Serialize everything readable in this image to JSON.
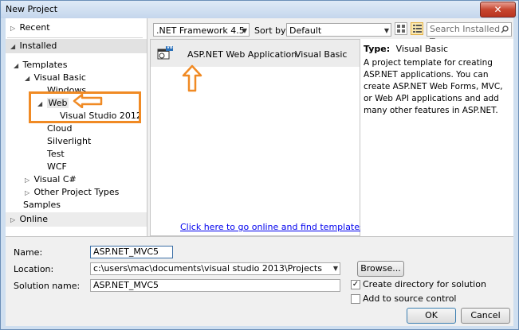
{
  "window": {
    "title": "New Project",
    "close_glyph": "✕"
  },
  "tree": {
    "recent": "Recent",
    "installed": "Installed",
    "templates": "Templates",
    "visual_basic": "Visual Basic",
    "windows": "Windows",
    "web": "Web",
    "visual_studio_2012": "Visual Studio 2012",
    "cloud": "Cloud",
    "silverlight": "Silverlight",
    "test": "Test",
    "wcf": "WCF",
    "visual_csharp": "Visual C#",
    "other_project_types": "Other Project Types",
    "samples": "Samples",
    "online": "Online"
  },
  "toolbar": {
    "framework": ".NET Framework 4.5",
    "sort_label": "Sort by:",
    "sort_value": "Default",
    "search_placeholder": "Search Installed Te"
  },
  "templates": [
    {
      "name": "ASP.NET Web Application",
      "language": "Visual Basic",
      "badge": "VB"
    }
  ],
  "online_link": "Click here to go online and find templates.",
  "details": {
    "type_label": "Type:",
    "type_value": "Visual Basic",
    "description": "A project template for creating ASP.NET applications. You can create ASP.NET Web Forms, MVC,  or Web API applications and add many other features in ASP.NET."
  },
  "form": {
    "name_label": "Name:",
    "name_value": "ASP.NET_MVC5",
    "location_label": "Location:",
    "location_value": "c:\\users\\mac\\documents\\visual studio 2013\\Projects",
    "solution_label": "Solution name:",
    "solution_value": "ASP.NET_MVC5",
    "browse": "Browse...",
    "create_dir": "Create directory for solution",
    "create_dir_checked": true,
    "add_source": "Add to source control",
    "add_source_checked": false,
    "ok": "OK",
    "cancel": "Cancel"
  },
  "colors": {
    "annotation": "#f08a24",
    "link": "#0000ee",
    "close": "#c7462f"
  }
}
